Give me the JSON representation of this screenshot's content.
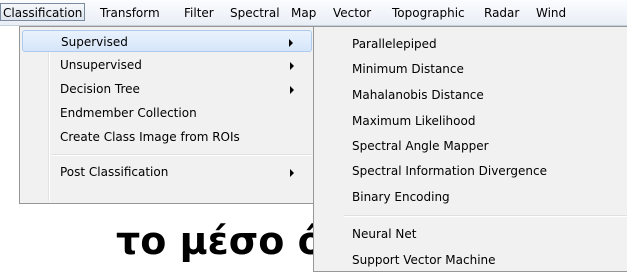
{
  "menubar": {
    "items": [
      "Classification",
      "Transform",
      "Filter",
      "Spectral",
      "Map",
      "Vector",
      "Topographic",
      "Radar",
      "Wind"
    ]
  },
  "dropdown": {
    "items": [
      {
        "label": "Supervised",
        "has_submenu": true
      },
      {
        "label": "Unsupervised",
        "has_submenu": true
      },
      {
        "label": "Decision Tree",
        "has_submenu": true
      },
      {
        "label": "Endmember Collection",
        "has_submenu": false
      },
      {
        "label": "Create Class Image from ROIs",
        "has_submenu": false
      },
      {
        "label": "Post Classification",
        "has_submenu": true
      }
    ]
  },
  "submenu": {
    "items": [
      "Parallelepiped",
      "Minimum Distance",
      "Mahalanobis Distance",
      "Maximum Likelihood",
      "Spectral Angle Mapper",
      "Spectral Information Divergence",
      "Binary Encoding",
      "Neural Net",
      "Support Vector Machine"
    ]
  },
  "background": {
    "text": "το μέσο όρο"
  }
}
